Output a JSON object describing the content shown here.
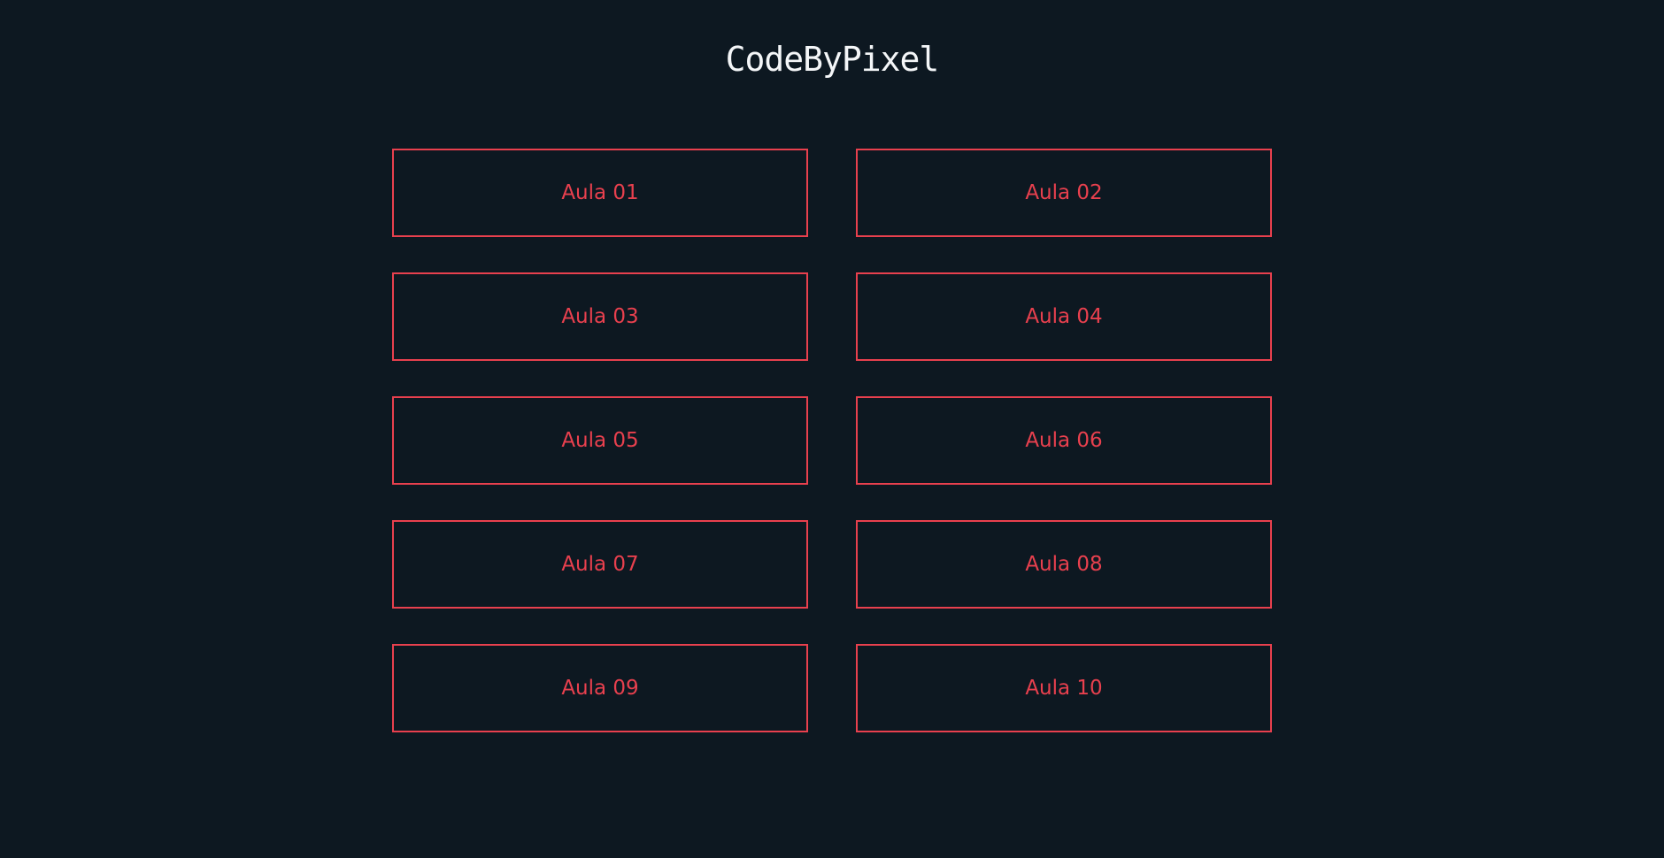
{
  "header": {
    "logo_text": "CodeByPixel"
  },
  "lessons": [
    {
      "label": "Aula 01"
    },
    {
      "label": "Aula 02"
    },
    {
      "label": "Aula 03"
    },
    {
      "label": "Aula 04"
    },
    {
      "label": "Aula 05"
    },
    {
      "label": "Aula 06"
    },
    {
      "label": "Aula 07"
    },
    {
      "label": "Aula 08"
    },
    {
      "label": "Aula 09"
    },
    {
      "label": "Aula 10"
    }
  ],
  "colors": {
    "background": "#0d1821",
    "accent": "#e8404e",
    "logo": "#f4f6f8"
  }
}
